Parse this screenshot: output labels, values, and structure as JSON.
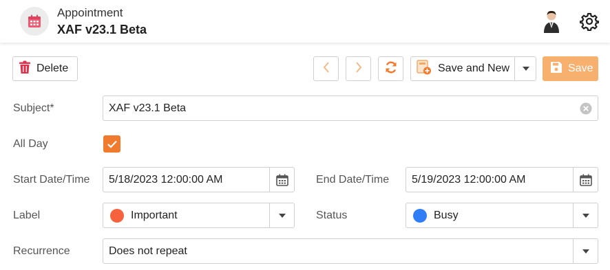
{
  "header": {
    "object_type": "Appointment",
    "title": "XAF v23.1 Beta"
  },
  "toolbar": {
    "delete_label": "Delete",
    "save_and_new_label": "Save and New",
    "save_label": "Save"
  },
  "form": {
    "subject": {
      "label": "Subject*",
      "value": "XAF v23.1 Beta"
    },
    "all_day": {
      "label": "All Day",
      "checked": true
    },
    "start": {
      "label": "Start Date/Time",
      "value": "5/18/2023 12:00:00 AM"
    },
    "end": {
      "label": "End Date/Time",
      "value": "5/19/2023 12:00:00 AM"
    },
    "label_field": {
      "label": "Label",
      "value": "Important",
      "color": "#f5623d"
    },
    "status": {
      "label": "Status",
      "value": "Busy",
      "color": "#2f7ef5"
    },
    "recurrence": {
      "label": "Recurrence",
      "value": "Does not repeat"
    }
  },
  "colors": {
    "accent": "#f07a2e",
    "save_button": "#f8b06f",
    "delete_icon": "#e0324b",
    "app_icon": "#ef5b73"
  },
  "icons": {
    "app": "calendar-icon",
    "user": "avatar",
    "settings": "gear-icon"
  }
}
